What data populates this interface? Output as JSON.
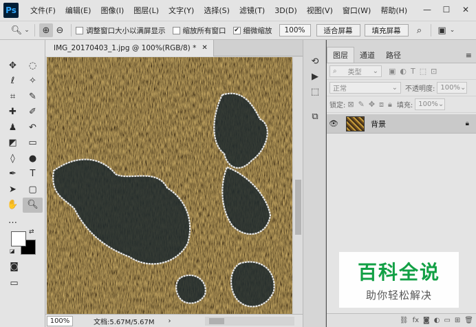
{
  "app": {
    "logo": "Ps"
  },
  "menu": [
    "文件(F)",
    "编辑(E)",
    "图像(I)",
    "图层(L)",
    "文字(Y)",
    "选择(S)",
    "滤镜(T)",
    "3D(D)",
    "视图(V)",
    "窗口(W)",
    "帮助(H)"
  ],
  "window_controls": {
    "minimize": "—",
    "maximize": "☐",
    "close": "✕"
  },
  "options": {
    "resize_windows": {
      "label": "调整窗口大小以满屏显示",
      "checked": false
    },
    "zoom_all": {
      "label": "缩放所有窗口",
      "checked": false
    },
    "scrubby_zoom": {
      "label": "细微缩放",
      "checked": true
    },
    "zoom_value": "100%",
    "fit_screen": "适合屏幕",
    "fill_screen": "填充屏幕"
  },
  "document": {
    "tab_title": "IMG_20170403_1.jpg @ 100%(RGB/8) *",
    "zoom": "100%",
    "doc_info": "文档:5.67M/5.67M"
  },
  "layers_panel": {
    "tabs": [
      "图层",
      "通道",
      "路径"
    ],
    "filter_kind": "类型",
    "blend_mode": "正常",
    "opacity_label": "不透明度:",
    "opacity_value": "100%",
    "lock_label": "锁定:",
    "fill_label": "填充:",
    "fill_value": "100%",
    "layers": [
      {
        "name": "背景",
        "visible": true,
        "locked": true
      }
    ]
  },
  "watermark": {
    "title": "百科全说",
    "subtitle": "助你轻松解决"
  },
  "colors": {
    "foreground": "#ffffff",
    "background": "#000000",
    "watermark_green": "#12a045"
  }
}
